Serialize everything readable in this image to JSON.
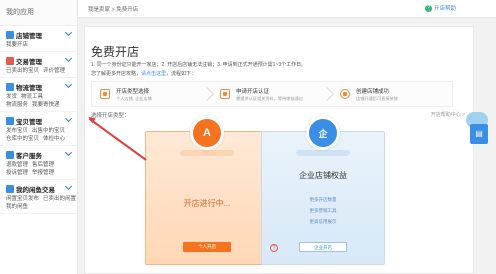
{
  "sidebar": {
    "title": "我的应用",
    "groups": [
      {
        "label": "店铺管理",
        "color": "#3a8ee6",
        "subs": [
          "我要开店"
        ]
      },
      {
        "label": "交易管理",
        "color": "#e55b4c",
        "subs": [
          "已卖出的宝贝",
          "评价管理"
        ]
      },
      {
        "label": "物流管理",
        "color": "#3a8ee6",
        "subs": [
          "发货",
          "物流工具",
          "物流服务",
          "我要寄快递"
        ]
      },
      {
        "label": "宝贝管理",
        "color": "#3a8ee6",
        "subs": [
          "发布宝贝",
          "出售中的宝贝",
          "仓库中的宝贝",
          "体检中心"
        ]
      },
      {
        "label": "客户服务",
        "color": "#3a8ee6",
        "subs": [
          "退款管理",
          "售后管理",
          "投诉管理",
          "举报管理"
        ]
      },
      {
        "label": "我的闲鱼交易",
        "color": "#3a8ee6",
        "subs": [
          "闲置宝贝发布",
          "已卖出的闲置",
          "我的闲鱼"
        ]
      }
    ]
  },
  "topbar": {
    "breadcrumb": "我是卖家 > 免费开店",
    "help": "开店帮助"
  },
  "main": {
    "title": "免费开店",
    "intro": "1. 同一个身份证只能开一家店；2. 开店后店铺无法注销；3. 申请到正式开通预计需1~3个工作日。",
    "intro2_prefix": "您了解更多开店攻略，",
    "intro2_link": "请点击这里",
    "intro2_suffix": "，流程如下：",
    "steps": [
      {
        "title": "开店类型选择",
        "sub": "个人店铺, 企业店铺"
      },
      {
        "title": "申请开店认证",
        "sub": "需提供认证相关资料，等待审核通过"
      },
      {
        "title": "创建店铺成功",
        "sub": "店铺开通后可直接装修"
      }
    ],
    "select_label": "选择开店类型：",
    "right_hint": "开店帮助中心 >",
    "personal": {
      "badge": "A",
      "status": "开店进行中...",
      "button": "个人开店"
    },
    "enterprise": {
      "badge": "企",
      "title": "企业店铺权益",
      "benefits": [
        "更多开店数量",
        "更多营销工具",
        "更高信用展示"
      ],
      "button": "企业开店"
    }
  },
  "colors": {
    "accent_blue": "#3a8ee6",
    "accent_orange": "#f5731f",
    "annotation_red": "#e23c3c"
  }
}
